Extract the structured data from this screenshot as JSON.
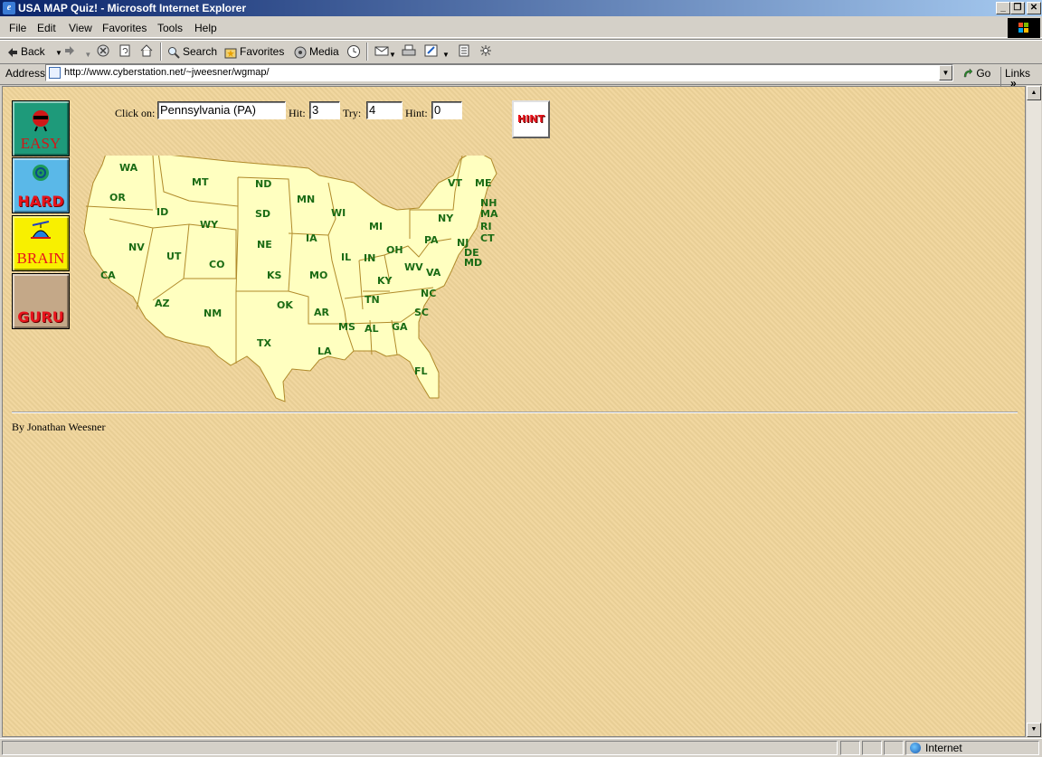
{
  "window": {
    "title": "USA MAP Quiz! - Microsoft Internet Explorer",
    "minimize": "_",
    "restore": "❐",
    "close": "✕"
  },
  "menu": [
    "File",
    "Edit",
    "View",
    "Favorites",
    "Tools",
    "Help"
  ],
  "toolbar": {
    "back": "Back",
    "search": "Search",
    "favorites": "Favorites",
    "media": "Media"
  },
  "address": {
    "label": "Address",
    "url": "http://www.cyberstation.net/~jweesner/wgmap/",
    "go": "Go",
    "links": "Links",
    "links_chevron": "»"
  },
  "quiz": {
    "click_on_label": "Click on:",
    "click_on_value": "Pennsylvania (PA)",
    "hit_label": "Hit:",
    "hit_value": "3",
    "try_label": "Try:",
    "try_value": "4",
    "hint_label": "Hint:",
    "hint_value": "0",
    "hint_button": "HINT"
  },
  "levels": [
    {
      "label": "EASY",
      "color": "#1e9a7a"
    },
    {
      "label": "HARD",
      "color": "#5ab8e8"
    },
    {
      "label": "BRAIN",
      "color": "#f8f000"
    },
    {
      "label": "GURU",
      "color": "#c4a888"
    }
  ],
  "states": [
    "WA",
    "OR",
    "CA",
    "ID",
    "NV",
    "MT",
    "WY",
    "UT",
    "AZ",
    "CO",
    "NM",
    "ND",
    "SD",
    "NE",
    "KS",
    "OK",
    "TX",
    "MN",
    "IA",
    "MO",
    "AR",
    "LA",
    "WI",
    "IL",
    "MS",
    "MI",
    "IN",
    "KY",
    "TN",
    "AL",
    "OH",
    "WV",
    "VA",
    "NC",
    "SC",
    "GA",
    "FL",
    "PA",
    "NY",
    "VT",
    "ME",
    "NH",
    "MA",
    "RI",
    "CT",
    "NJ",
    "DE",
    "MD"
  ],
  "author": "By Jonathan Weesner",
  "status": {
    "zone": "Internet"
  }
}
